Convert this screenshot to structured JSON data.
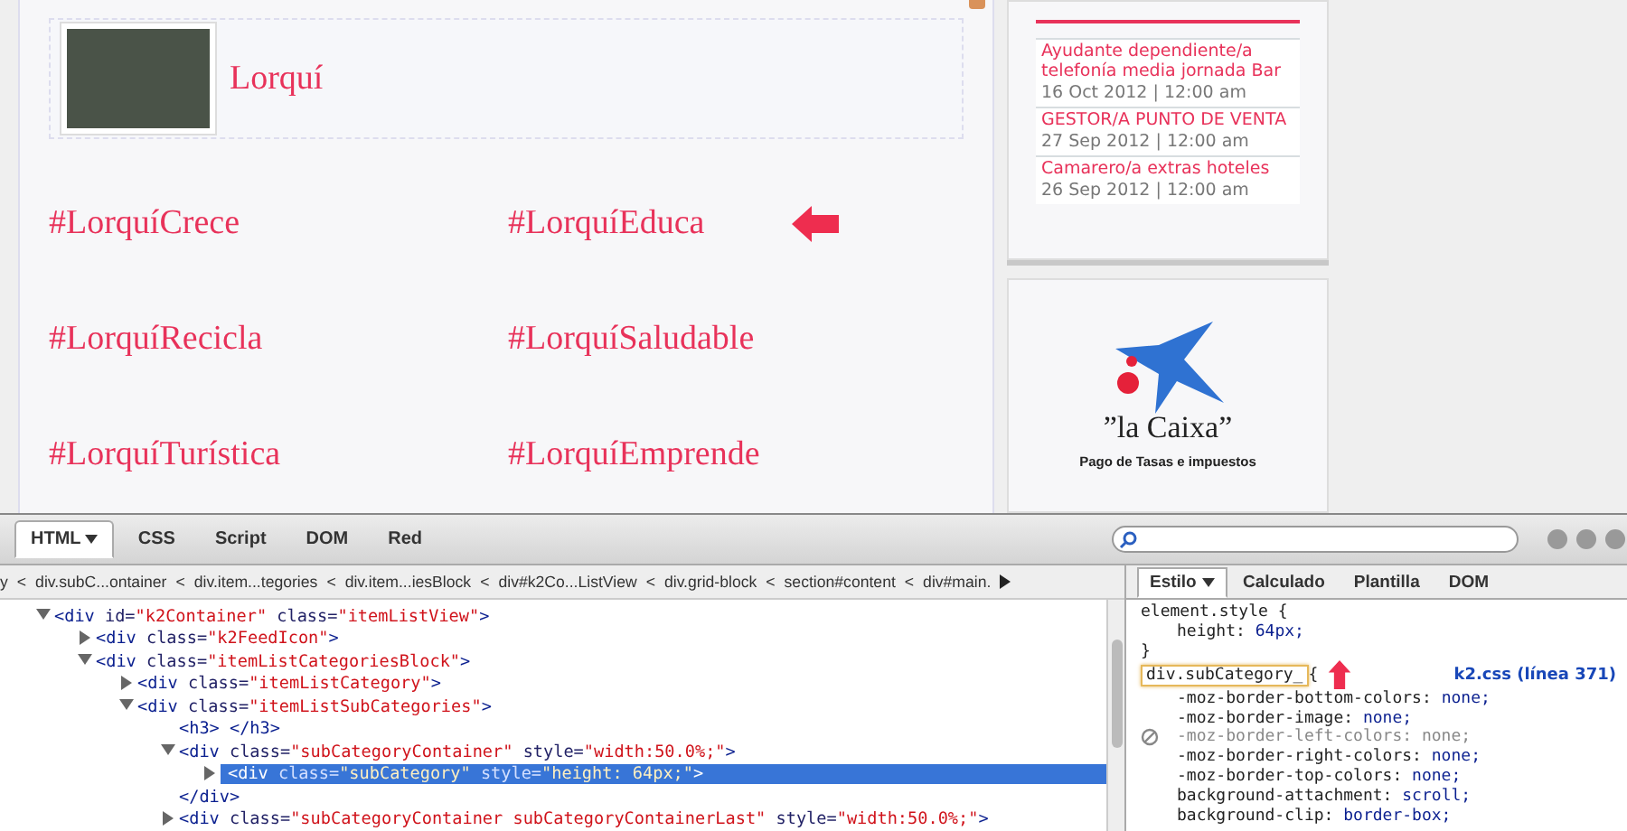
{
  "category": {
    "title": "Lorquí"
  },
  "subcategories": [
    {
      "label": "#LorquíCrece",
      "arrow": false
    },
    {
      "label": "#LorquíEduca",
      "arrow": true
    },
    {
      "label": "#LorquíRecicla",
      "arrow": false
    },
    {
      "label": "#LorquíSaludable",
      "arrow": false
    },
    {
      "label": "#LorquíTurística",
      "arrow": false
    },
    {
      "label": "#LorquíEmprende",
      "arrow": false
    }
  ],
  "jobs": [
    {
      "title": "Ayudante dependiente/a telefonía media jornada Bar",
      "date": "16 Oct 2012 | 12:00 am"
    },
    {
      "title": "GESTOR/A PUNTO DE VENTA",
      "date": "27 Sep 2012 | 12:00 am"
    },
    {
      "title": "Camarero/a extras hoteles",
      "date": "26 Sep 2012 | 12:00 am"
    }
  ],
  "sponsor": {
    "name": "”la Caixa”",
    "caption": "Pago de Tasas e impuestos"
  },
  "devtools": {
    "tabs": [
      {
        "label": "HTML",
        "selected": true,
        "menu": true
      },
      {
        "label": "CSS",
        "selected": false,
        "menu": false
      },
      {
        "label": "Script",
        "selected": false,
        "menu": false
      },
      {
        "label": "DOM",
        "selected": false,
        "menu": false
      },
      {
        "label": "Red",
        "selected": false,
        "menu": false
      }
    ],
    "breadcrumbs": [
      {
        "label": "y"
      },
      {
        "separator": "<",
        "label": "div.subC...ontainer"
      },
      {
        "separator": "<",
        "label": "div.item...tegories"
      },
      {
        "separator": "<",
        "label": "div.item...iesBlock"
      },
      {
        "separator": "<",
        "label": "div#k2Co...ListView"
      },
      {
        "separator": "<",
        "label": "div.grid-block"
      },
      {
        "separator": "<",
        "label": "section#content"
      },
      {
        "separator": "<",
        "label": "div#main."
      }
    ],
    "tree": [
      {
        "expandable": true,
        "expanded": true,
        "selected": false,
        "segments": [
          {
            "kind": "tag",
            "text": "<div"
          },
          {
            "kind": "attr",
            "text": " id="
          },
          {
            "kind": "value",
            "text": "\"k2Container\""
          },
          {
            "kind": "attr",
            "text": " class="
          },
          {
            "kind": "value",
            "text": "\"itemListView\""
          },
          {
            "kind": "tag",
            "text": ">"
          }
        ],
        "children": [
          {
            "expandable": true,
            "expanded": false,
            "selected": false,
            "segments": [
              {
                "kind": "tag",
                "text": "<div"
              },
              {
                "kind": "attr",
                "text": " class="
              },
              {
                "kind": "value",
                "text": "\"k2FeedIcon\""
              },
              {
                "kind": "tag",
                "text": ">"
              }
            ]
          },
          {
            "expandable": true,
            "expanded": true,
            "selected": false,
            "segments": [
              {
                "kind": "tag",
                "text": "<div"
              },
              {
                "kind": "attr",
                "text": " class="
              },
              {
                "kind": "value",
                "text": "\"itemListCategoriesBlock\""
              },
              {
                "kind": "tag",
                "text": ">"
              }
            ],
            "children": [
              {
                "expandable": true,
                "expanded": false,
                "selected": false,
                "segments": [
                  {
                    "kind": "tag",
                    "text": "<div"
                  },
                  {
                    "kind": "attr",
                    "text": " class="
                  },
                  {
                    "kind": "value",
                    "text": "\"itemListCategory\""
                  },
                  {
                    "kind": "tag",
                    "text": ">"
                  }
                ]
              },
              {
                "expandable": true,
                "expanded": true,
                "selected": false,
                "segments": [
                  {
                    "kind": "tag",
                    "text": "<div"
                  },
                  {
                    "kind": "attr",
                    "text": " class="
                  },
                  {
                    "kind": "value",
                    "text": "\"itemListSubCategories\""
                  },
                  {
                    "kind": "tag",
                    "text": ">"
                  }
                ],
                "children": [
                  {
                    "expandable": false,
                    "expanded": false,
                    "selected": false,
                    "segments": [
                      {
                        "kind": "tag",
                        "text": "<h3> </h3>"
                      }
                    ]
                  },
                  {
                    "expandable": true,
                    "expanded": true,
                    "selected": false,
                    "segments": [
                      {
                        "kind": "tag",
                        "text": "<div"
                      },
                      {
                        "kind": "attr",
                        "text": " class="
                      },
                      {
                        "kind": "value",
                        "text": "\"subCategoryContainer\""
                      },
                      {
                        "kind": "attr",
                        "text": " style="
                      },
                      {
                        "kind": "value",
                        "text": "\"width:50.0%;\""
                      },
                      {
                        "kind": "tag",
                        "text": ">"
                      }
                    ],
                    "children": [
                      {
                        "expandable": true,
                        "expanded": false,
                        "selected": true,
                        "segments": [
                          {
                            "kind": "tag",
                            "text": "<div"
                          },
                          {
                            "kind": "attr",
                            "text": " class="
                          },
                          {
                            "kind": "value",
                            "text": "\"subCategory\""
                          },
                          {
                            "kind": "attr",
                            "text": " style="
                          },
                          {
                            "kind": "value",
                            "text": "\"height: 64px;\""
                          },
                          {
                            "kind": "tag",
                            "text": ">"
                          }
                        ]
                      }
                    ]
                  },
                  {
                    "expandable": false,
                    "expanded": false,
                    "selected": false,
                    "segments": [
                      {
                        "kind": "tag",
                        "text": "</div>"
                      }
                    ]
                  },
                  {
                    "expandable": true,
                    "expanded": false,
                    "selected": false,
                    "segments": [
                      {
                        "kind": "tag",
                        "text": "<div"
                      },
                      {
                        "kind": "attr",
                        "text": " class="
                      },
                      {
                        "kind": "value",
                        "text": "\"subCategoryContainer subCategoryContainerLast\""
                      },
                      {
                        "kind": "attr",
                        "text": " style="
                      },
                      {
                        "kind": "value",
                        "text": "\"width:50.0%;\""
                      },
                      {
                        "kind": "tag",
                        "text": ">"
                      }
                    ]
                  }
                ]
              }
            ]
          }
        ]
      }
    ],
    "side_tabs": [
      {
        "label": "Estilo",
        "selected": true,
        "menu": true
      },
      {
        "label": "Calculado",
        "selected": false,
        "menu": false
      },
      {
        "label": "Plantilla",
        "selected": false,
        "menu": false
      },
      {
        "label": "DOM",
        "selected": false,
        "menu": false
      }
    ],
    "css": [
      {
        "kind": "text",
        "text": "element.style {"
      },
      {
        "kind": "prop",
        "name": "height:",
        "value": "64px;",
        "disabled": false
      },
      {
        "kind": "text",
        "text": "}"
      },
      {
        "kind": "selector",
        "selector": "div.subCategory_",
        "brace": "{",
        "source": "k2.css (línea 371)"
      },
      {
        "kind": "prop",
        "name": "-moz-border-bottom-colors:",
        "value": "none;",
        "disabled": false
      },
      {
        "kind": "prop",
        "name": "-moz-border-image:",
        "value": "none;",
        "disabled": false
      },
      {
        "kind": "prop",
        "name": "-moz-border-left-colors:",
        "value": "none;",
        "disabled": true
      },
      {
        "kind": "prop",
        "name": "-moz-border-right-colors:",
        "value": "none;",
        "disabled": false
      },
      {
        "kind": "prop",
        "name": "-moz-border-top-colors:",
        "value": "none;",
        "disabled": false
      },
      {
        "kind": "prop",
        "name": "background-attachment:",
        "value": "scroll;",
        "disabled": false
      },
      {
        "kind": "prop",
        "name": "background-clip:",
        "value": "border-box;",
        "disabled": false
      }
    ]
  }
}
